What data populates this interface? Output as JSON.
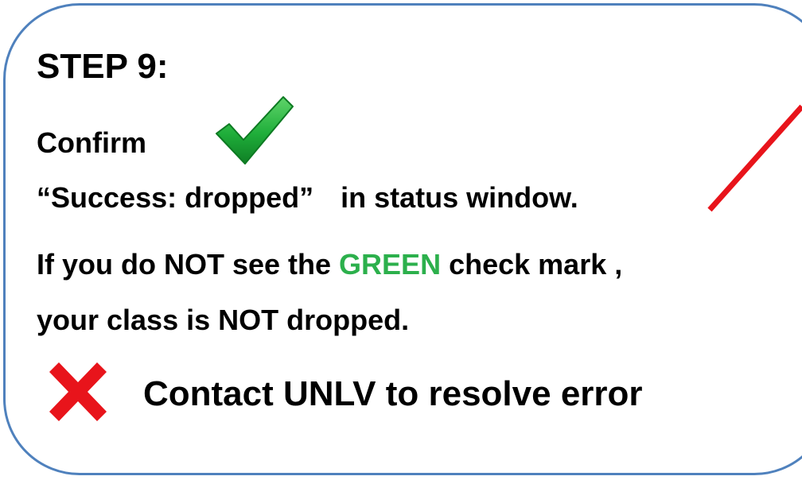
{
  "card": {
    "title": "STEP 9:",
    "confirm_label": "Confirm",
    "success_quote": "“Success:  dropped”",
    "success_suffix": "in status window.",
    "warning_part1": "If you do NOT see the ",
    "warning_highlight": "GREEN",
    "warning_part2": " check mark ,",
    "warning_line2": "your class is NOT dropped.",
    "contact_text": "Contact UNLV to resolve  error"
  },
  "icons": {
    "check": "green-check-mark-icon",
    "cross": "red-x-icon",
    "slash": "red-slash-line"
  },
  "colors": {
    "border": "#4f81bd",
    "highlight_green": "#2cb04c",
    "check_green": "#1fae3a",
    "error_red": "#e8141b"
  }
}
